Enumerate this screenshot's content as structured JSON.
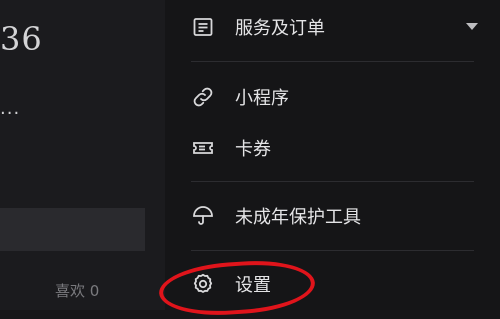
{
  "left": {
    "count_suffix": "36",
    "ellipsis": "...",
    "likes_label": "喜欢 0"
  },
  "menu": {
    "items": [
      {
        "label": "服务及订单",
        "icon": "document-list-icon",
        "has_dropdown": true
      },
      {
        "label": "小程序",
        "icon": "mini-program-link-icon"
      },
      {
        "label": "卡券",
        "icon": "coupon-ticket-icon"
      },
      {
        "label": "未成年保护工具",
        "icon": "umbrella-icon"
      },
      {
        "label": "设置",
        "icon": "gear-icon"
      }
    ]
  },
  "colors": {
    "background": "#151517",
    "text": "#e4e4e6",
    "annotation": "#e0141b"
  }
}
